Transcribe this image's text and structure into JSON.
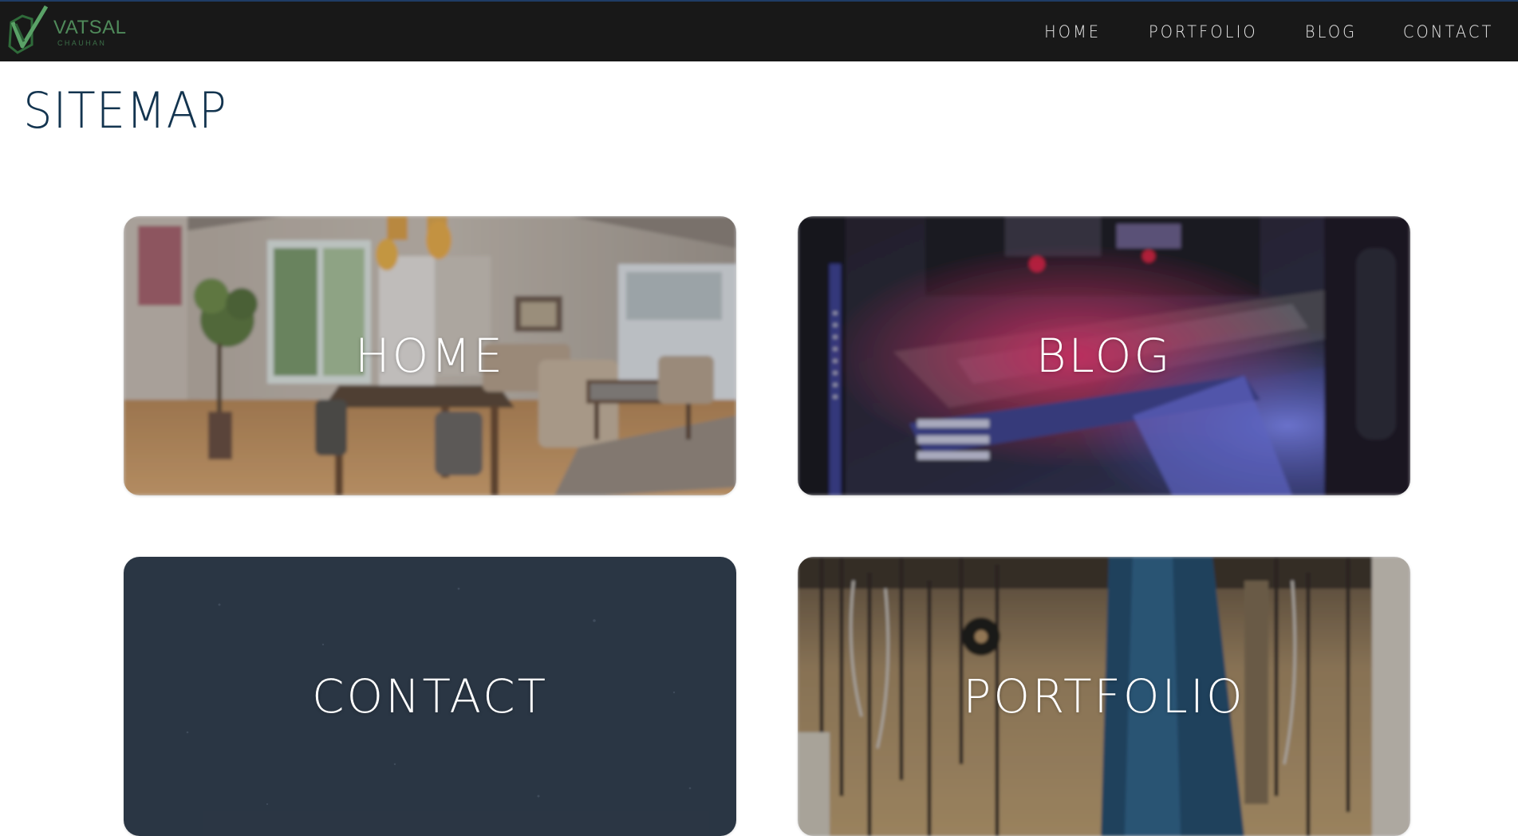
{
  "logo": {
    "name": "VATSAL",
    "subtitle": "CHAUHAN",
    "icon": "checkmark-logo-icon",
    "color": "#4f8a5a"
  },
  "nav": {
    "items": [
      {
        "label": "HOME"
      },
      {
        "label": "PORTFOLIO"
      },
      {
        "label": "BLOG"
      },
      {
        "label": "CONTACT"
      }
    ]
  },
  "page": {
    "title": "SITEMAP"
  },
  "tiles": [
    {
      "label": "HOME",
      "image": "living-room-photo"
    },
    {
      "label": "BLOG",
      "image": "pc-hardware-photo"
    },
    {
      "label": "CONTACT",
      "image": "night-sky-photo"
    },
    {
      "label": "PORTFOLIO",
      "image": "workshop-tools-photo"
    }
  ],
  "colors": {
    "header_bg": "#181818",
    "header_accent": "#1f3c66",
    "title": "#13344f",
    "nav_text": "#e9e9e9"
  }
}
